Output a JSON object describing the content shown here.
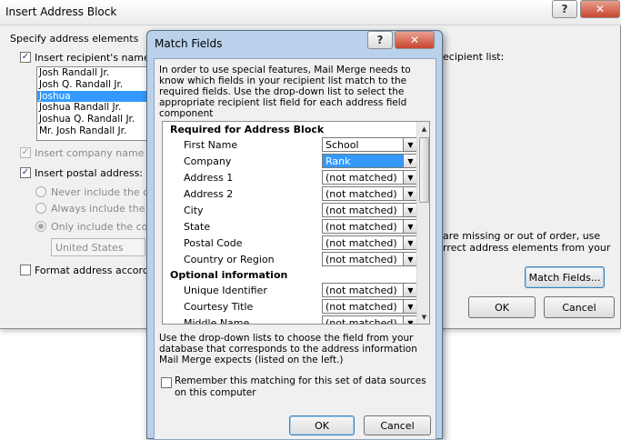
{
  "bg_dialog": {
    "title": "Insert Address Block",
    "help_label": "?",
    "close_label": "✕",
    "specify_legend": "Specify address elements",
    "insert_name_label": "Insert recipient's name in",
    "names": [
      "Josh Randall Jr.",
      "Josh Q. Randall Jr.",
      "Joshua",
      "Joshua Randall Jr.",
      "Joshua Q. Randall Jr.",
      "Mr. Josh Randall Jr."
    ],
    "selected_name_index": 2,
    "insert_company_label": "Insert company name",
    "insert_postal_label": "Insert postal address:",
    "never_include_label": "Never include the cou",
    "always_include_label": "Always include the co",
    "only_include_label": "Only include the coun",
    "country_value": "United States",
    "format_address_label": "Format address according",
    "recipient_list_label": "ecipient list:",
    "missing_text_line1": "are missing or out of order, use",
    "missing_text_line2": "rrect address elements from your",
    "match_fields_button": "Match Fields...",
    "ok_label": "OK",
    "cancel_label": "Cancel"
  },
  "match_fields": {
    "title": "Match Fields",
    "help_label": "?",
    "close_label": "✕",
    "intro": "In order to use special features, Mail Merge needs to know which fields in your recipient list match to the required fields. Use the drop-down list to select the appropriate recipient list field for each address field component",
    "required_header": "Required for Address Block",
    "required_fields": [
      {
        "label": "First Name",
        "value": "School"
      },
      {
        "label": "Company",
        "value": "Rank"
      },
      {
        "label": "Address 1",
        "value": "(not matched)"
      },
      {
        "label": "Address 2",
        "value": "(not matched)"
      },
      {
        "label": "City",
        "value": "(not matched)"
      },
      {
        "label": "State",
        "value": "(not matched)"
      },
      {
        "label": "Postal Code",
        "value": "(not matched)"
      },
      {
        "label": "Country or Region",
        "value": "(not matched)"
      }
    ],
    "optional_header": "Optional information",
    "optional_fields": [
      {
        "label": "Unique Identifier",
        "value": "(not matched)"
      },
      {
        "label": "Courtesy Title",
        "value": "(not matched)"
      },
      {
        "label": "Middle Name",
        "value": "(not matched)"
      }
    ],
    "hint": "Use the drop-down lists to choose the field from your database that corresponds to the address information Mail Merge expects (listed on the left.)",
    "remember_label": "Remember this matching for this set of data sources on this computer",
    "remember_checked": false,
    "ok_label": "OK",
    "cancel_label": "Cancel"
  },
  "colors": {
    "selection": "#3399ff",
    "dialog_bg": "#f0f0f0",
    "frame": "#b9d1ea"
  },
  "icons": {
    "dropdown": "chevron-down-icon",
    "scroll_up": "scroll-up-icon",
    "scroll_down": "scroll-down-icon",
    "check": "checkmark-icon"
  }
}
